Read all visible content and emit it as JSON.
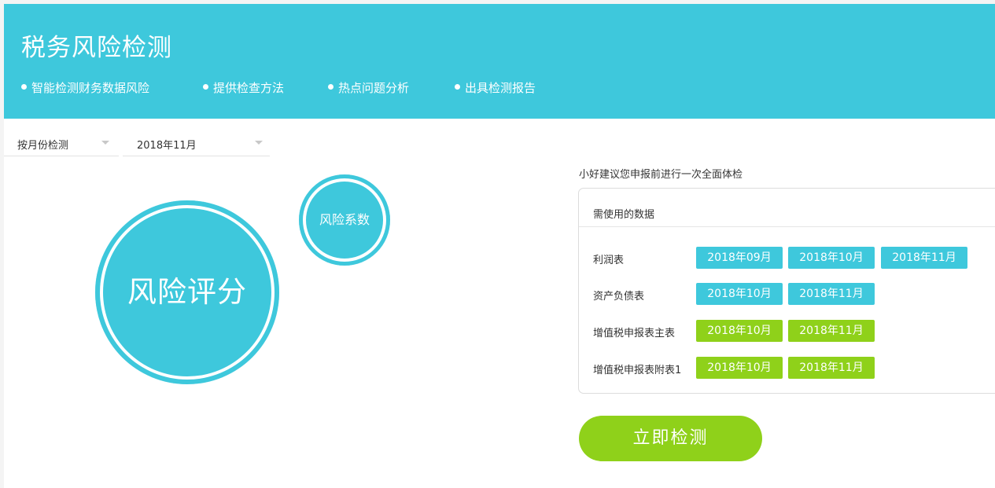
{
  "header": {
    "title": "税务风险检测",
    "features": [
      "智能检测财务数据风险",
      "提供检查方法",
      "热点问题分析",
      "出具检测报告"
    ]
  },
  "filters": {
    "mode": "按月份检测",
    "month": "2018年11月"
  },
  "score": {
    "main_label": "风险评分",
    "sub_label": "风险系数"
  },
  "panel": {
    "suggestion": "小好建议您申报前进行一次全面体检",
    "heading": "需使用的数据",
    "rows": [
      {
        "label": "利润表",
        "months": [
          "2018年09月",
          "2018年10月",
          "2018年11月"
        ],
        "status": "blue"
      },
      {
        "label": "资产负债表",
        "months": [
          "2018年10月",
          "2018年11月"
        ],
        "status": "blue"
      },
      {
        "label": "增值税申报表主表",
        "months": [
          "2018年10月",
          "2018年11月"
        ],
        "status": "green"
      },
      {
        "label": "增值税申报表附表1",
        "months": [
          "2018年10月",
          "2018年11月"
        ],
        "status": "green"
      }
    ]
  },
  "actions": {
    "detect_label": "立即检测"
  },
  "colors": {
    "primary": "#3ec8dc",
    "accent": "#8fd11a"
  }
}
